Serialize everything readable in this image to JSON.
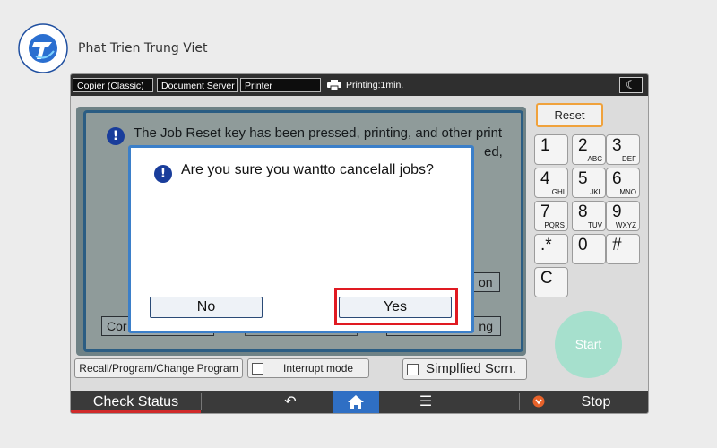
{
  "brand": {
    "name": "Phat Trien Trung Viet",
    "logo_text": "PHAT TRIEN TRUNG VIET"
  },
  "tabs": [
    "Copier (Classic)",
    "Document Server",
    "Printer"
  ],
  "status": {
    "printing": "Printing:1min."
  },
  "background_dialog": {
    "message_line1": "The Job Reset key has been pressed, printing, and other print",
    "message_line2_tail": "ed,",
    "button_fragment_right": "on",
    "button_fragment_left": "Cor",
    "button_fragment_bottom_right": "ng"
  },
  "modal": {
    "message": "Are you sure you wantto cancelall jobs?",
    "no_label": "No",
    "yes_label": "Yes"
  },
  "keypad": {
    "reset_label": "Reset",
    "keys": [
      {
        "digit": "1",
        "letters": ""
      },
      {
        "digit": "2",
        "letters": "ABC"
      },
      {
        "digit": "3",
        "letters": "DEF"
      },
      {
        "digit": "4",
        "letters": "GHI"
      },
      {
        "digit": "5",
        "letters": "JKL"
      },
      {
        "digit": "6",
        "letters": "MNO"
      },
      {
        "digit": "7",
        "letters": "PQRS"
      },
      {
        "digit": "8",
        "letters": "TUV"
      },
      {
        "digit": "9",
        "letters": "WXYZ"
      },
      {
        "digit": ".*",
        "letters": ""
      },
      {
        "digit": "0",
        "letters": ""
      },
      {
        "digit": "#",
        "letters": ""
      },
      {
        "digit": "C",
        "letters": ""
      }
    ],
    "start_label": "Start"
  },
  "toolbar": {
    "recall_label": "Recall/Program/Change Program",
    "interrupt_label": "Interrupt mode",
    "simplified_label": "Simplfied Scrn."
  },
  "bottom": {
    "check_status": "Check Status",
    "stop": "Stop"
  },
  "colors": {
    "modal_border": "#3b7fc9",
    "highlight": "#e01a22",
    "reset_border": "#f0a23c",
    "start": "#a6e0cd",
    "home_active": "#2f6fc4"
  }
}
